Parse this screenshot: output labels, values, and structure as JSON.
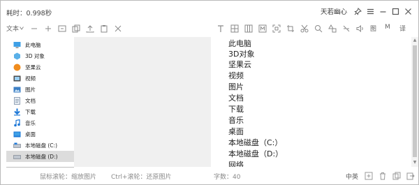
{
  "titlebar": {
    "elapsed": "耗时：0.998秒",
    "app_name": "天若幽心"
  },
  "toolbar": {
    "text_label": "文本",
    "image_label": "图",
    "m_label": "M",
    "translate_label": "译"
  },
  "sidebar": {
    "items": [
      {
        "label": "此电脑",
        "icon": "computer-icon"
      },
      {
        "label": "3D 对象",
        "icon": "3d-objects-icon"
      },
      {
        "label": "坚果云",
        "icon": "nutstore-icon"
      },
      {
        "label": "视频",
        "icon": "video-folder-icon"
      },
      {
        "label": "图片",
        "icon": "pictures-folder-icon"
      },
      {
        "label": "文档",
        "icon": "documents-folder-icon"
      },
      {
        "label": "下载",
        "icon": "downloads-icon"
      },
      {
        "label": "音乐",
        "icon": "music-icon"
      },
      {
        "label": "桌面",
        "icon": "desktop-icon"
      },
      {
        "label": "本地磁盘 (C:)",
        "icon": "drive-icon"
      },
      {
        "label": "本地磁盘 (D:)",
        "icon": "drive-icon"
      }
    ]
  },
  "content": {
    "lines": [
      "此电脑",
      "3D对象",
      "坚果云",
      "视频",
      "图片",
      "文档",
      "下载",
      "音乐",
      "桌面",
      "本地磁盘（C:）",
      "本地磁盘（D:）",
      "网络"
    ]
  },
  "statusbar": {
    "scroll_zoom": "鼠标滚轮：缩放图片",
    "ctrl_scroll": "Ctrl+滚轮：还原图片",
    "char_count": "字数：40",
    "lang": "中英"
  },
  "colors": {
    "accent_blue": "#1e78d7",
    "sidebar_selected": "#dcdcdc",
    "middle_panel": "#f0f0f0"
  }
}
